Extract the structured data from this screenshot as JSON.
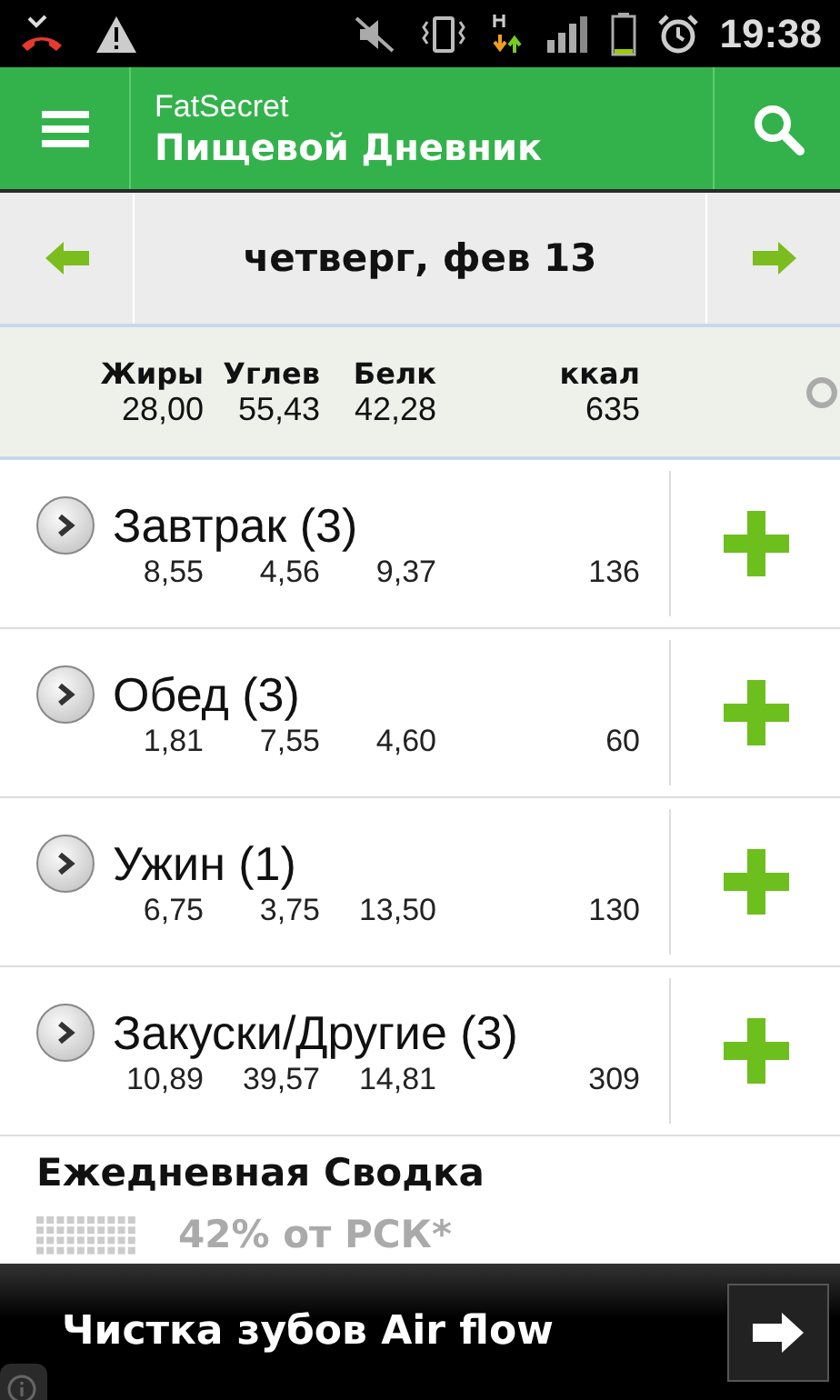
{
  "status_bar": {
    "time": "19:38"
  },
  "header": {
    "subtitle": "FatSecret",
    "title": "Пищевой Дневник"
  },
  "date_bar": {
    "date": "четверг, фев 13"
  },
  "totals": {
    "columns": [
      "Жиры",
      "Углев",
      "Белк",
      "ккал"
    ],
    "values": [
      "28,00",
      "55,43",
      "42,28",
      "635"
    ]
  },
  "meals": [
    {
      "name": "Завтрак (3)",
      "values": [
        "8,55",
        "4,56",
        "9,37",
        "136"
      ]
    },
    {
      "name": "Обед (3)",
      "values": [
        "1,81",
        "7,55",
        "4,60",
        "60"
      ]
    },
    {
      "name": "Ужин (1)",
      "values": [
        "6,75",
        "3,75",
        "13,50",
        "130"
      ]
    },
    {
      "name": "Закуски/Другие (3)",
      "values": [
        "10,89",
        "39,57",
        "14,81",
        "309"
      ]
    }
  ],
  "daily_summary": {
    "title": "Ежедневная Сводка",
    "rdi": "42% от РСК*"
  },
  "ad": {
    "text": "Чистка зубов Air flow"
  }
}
